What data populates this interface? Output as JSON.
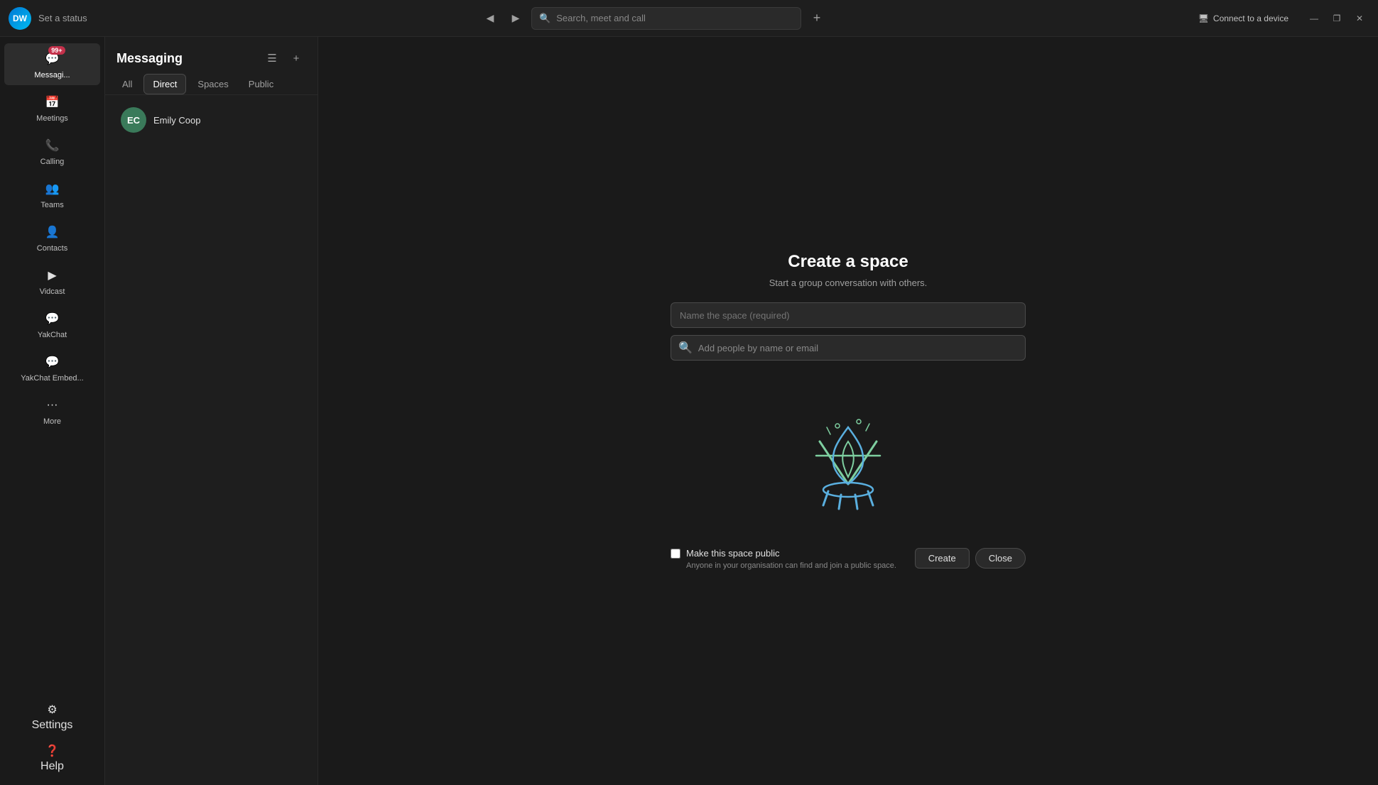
{
  "app": {
    "avatar_initials": "DW",
    "status_text": "Set a status",
    "search_placeholder": "Search, meet and call",
    "connect_device_label": "Connect to a device",
    "window_minimize": "—",
    "window_restore": "❐",
    "window_close": "✕"
  },
  "nav": {
    "back_label": "◀",
    "forward_label": "▶",
    "add_label": "+"
  },
  "sidebar": {
    "items": [
      {
        "id": "messaging",
        "label": "Messagi...",
        "icon": "💬",
        "badge": "99+"
      },
      {
        "id": "meetings",
        "label": "Meetings",
        "icon": "📅",
        "badge": null
      },
      {
        "id": "calling",
        "label": "Calling",
        "icon": "📞",
        "badge": null
      },
      {
        "id": "teams",
        "label": "Teams",
        "icon": "👥",
        "badge": null
      },
      {
        "id": "contacts",
        "label": "Contacts",
        "icon": "👤",
        "badge": null
      },
      {
        "id": "vidcast",
        "label": "Vidcast",
        "icon": "▶",
        "badge": null
      },
      {
        "id": "yakchat",
        "label": "YakChat",
        "icon": "💬",
        "badge": null
      },
      {
        "id": "yakchat-embed",
        "label": "YakChat Embed...",
        "icon": "💬",
        "badge": null
      },
      {
        "id": "more",
        "label": "More",
        "icon": "···",
        "badge": null
      }
    ],
    "bottom": [
      {
        "id": "settings",
        "label": "Settings",
        "icon": "⚙"
      },
      {
        "id": "help",
        "label": "Help",
        "icon": "?"
      }
    ]
  },
  "middle_panel": {
    "title": "Messaging",
    "filter_icon": "☰",
    "add_icon": "+",
    "tabs": [
      {
        "id": "all",
        "label": "All"
      },
      {
        "id": "direct",
        "label": "Direct"
      },
      {
        "id": "spaces",
        "label": "Spaces"
      },
      {
        "id": "public",
        "label": "Public"
      }
    ],
    "active_tab": "direct",
    "contacts": [
      {
        "id": "emily-coop",
        "initials": "EC",
        "name": "Emily Coop",
        "avatar_color": "#3a7a5a"
      }
    ]
  },
  "create_space": {
    "title": "Create a space",
    "subtitle": "Start a group conversation with others.",
    "name_placeholder": "Name the space (required)",
    "people_placeholder": "Add people by name or email",
    "public_label": "Make this space public",
    "public_description": "Anyone in your organisation can find and join a public space.",
    "create_button": "Create",
    "close_button": "Close"
  }
}
